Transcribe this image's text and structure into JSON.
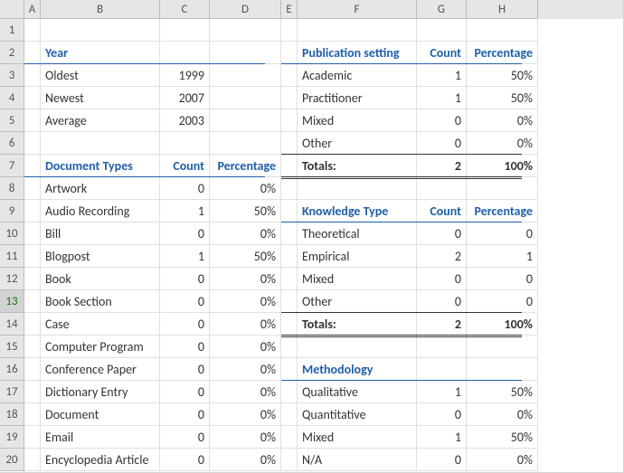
{
  "columns": [
    "A",
    "B",
    "C",
    "D",
    "E",
    "F",
    "G",
    "H"
  ],
  "rows": [
    "1",
    "2",
    "3",
    "4",
    "5",
    "6",
    "7",
    "8",
    "9",
    "10",
    "11",
    "12",
    "13",
    "14",
    "15",
    "16",
    "17",
    "18",
    "19",
    "20"
  ],
  "selectedRow": "13",
  "year": {
    "header": "Year",
    "rows": [
      {
        "label": "Oldest",
        "value": "1999"
      },
      {
        "label": "Newest",
        "value": "2007"
      },
      {
        "label": "Average",
        "value": "2003"
      }
    ]
  },
  "docTypes": {
    "header": "Document Types",
    "countHeader": "Count",
    "pctHeader": "Percentage",
    "rows": [
      {
        "label": "Artwork",
        "count": "0",
        "pct": "0%"
      },
      {
        "label": "Audio Recording",
        "count": "1",
        "pct": "50%"
      },
      {
        "label": "Bill",
        "count": "0",
        "pct": "0%"
      },
      {
        "label": "Blogpost",
        "count": "1",
        "pct": "50%"
      },
      {
        "label": "Book",
        "count": "0",
        "pct": "0%"
      },
      {
        "label": "Book Section",
        "count": "0",
        "pct": "0%"
      },
      {
        "label": "Case",
        "count": "0",
        "pct": "0%"
      },
      {
        "label": "Computer Program",
        "count": "0",
        "pct": "0%"
      },
      {
        "label": "Conference Paper",
        "count": "0",
        "pct": "0%"
      },
      {
        "label": "Dictionary Entry",
        "count": "0",
        "pct": "0%"
      },
      {
        "label": "Document",
        "count": "0",
        "pct": "0%"
      },
      {
        "label": "Email",
        "count": "0",
        "pct": "0%"
      },
      {
        "label": "Encyclopedia Article",
        "count": "0",
        "pct": "0%"
      }
    ]
  },
  "pubSetting": {
    "header": "Publication setting",
    "countHeader": "Count",
    "pctHeader": "Percentage",
    "rows": [
      {
        "label": "Academic",
        "count": "1",
        "pct": "50%"
      },
      {
        "label": "Practitioner",
        "count": "1",
        "pct": "50%"
      },
      {
        "label": "Mixed",
        "count": "0",
        "pct": "0%"
      },
      {
        "label": "Other",
        "count": "0",
        "pct": "0%"
      }
    ],
    "totals": {
      "label": "Totals:",
      "count": "2",
      "pct": "100%"
    }
  },
  "knowledge": {
    "header": "Knowledge Type",
    "countHeader": "Count",
    "pctHeader": "Percentage",
    "rows": [
      {
        "label": "Theoretical",
        "count": "0",
        "pct": "0"
      },
      {
        "label": "Empirical",
        "count": "2",
        "pct": "1"
      },
      {
        "label": "Mixed",
        "count": "0",
        "pct": "0"
      },
      {
        "label": "Other",
        "count": "0",
        "pct": "0"
      }
    ],
    "totals": {
      "label": "Totals:",
      "count": "2",
      "pct": "100%"
    }
  },
  "methodology": {
    "header": "Methodology",
    "rows": [
      {
        "label": "Qualitative",
        "count": "1",
        "pct": "50%"
      },
      {
        "label": "Quantitative",
        "count": "0",
        "pct": "0%"
      },
      {
        "label": "Mixed",
        "count": "1",
        "pct": "50%"
      },
      {
        "label": "N/A",
        "count": "0",
        "pct": "0%"
      }
    ]
  }
}
